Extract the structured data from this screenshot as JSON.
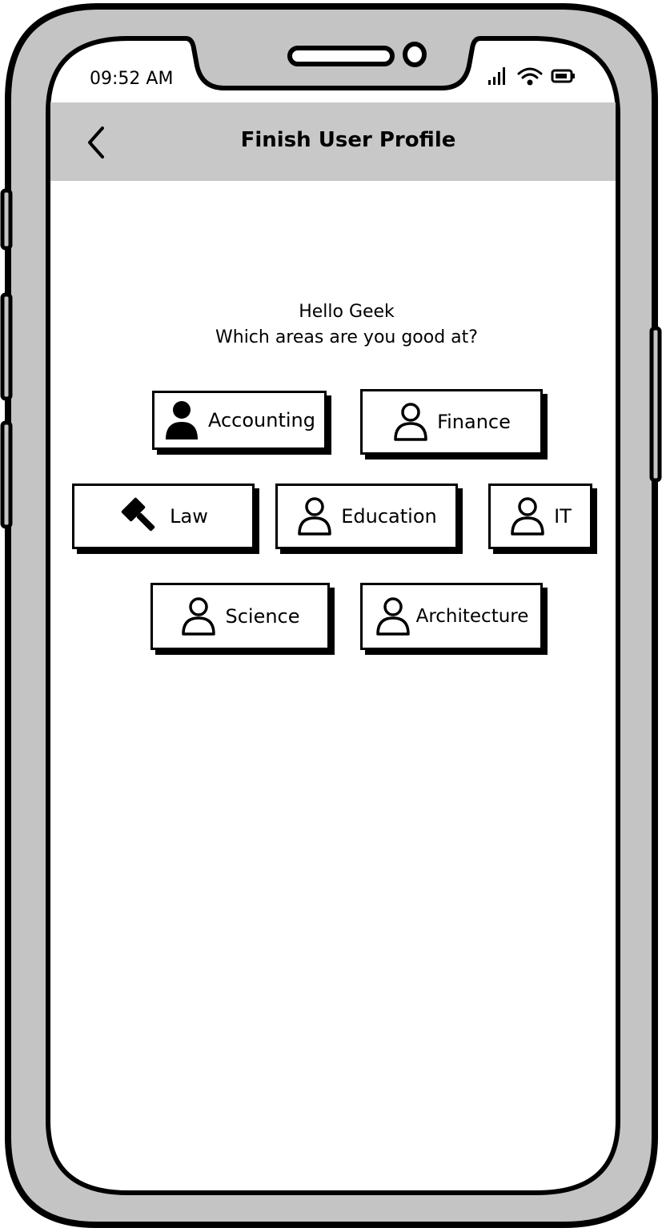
{
  "status_bar": {
    "time": "09:52 AM",
    "icons": [
      "signal-icon",
      "wifi-icon",
      "battery-icon"
    ]
  },
  "header": {
    "title": "Finish User Profile",
    "back_icon": "chevron-left-icon"
  },
  "greeting": {
    "line1": "Hello Geek",
    "line2": "Which areas are you good at?"
  },
  "areas": [
    {
      "label": "Accounting",
      "icon": "user-filled-icon",
      "selected": true
    },
    {
      "label": "Finance",
      "icon": "user-outline-icon",
      "selected": false
    },
    {
      "label": "Law",
      "icon": "gavel-icon",
      "selected": true
    },
    {
      "label": "Education",
      "icon": "user-outline-icon",
      "selected": false
    },
    {
      "label": "IT",
      "icon": "user-outline-icon",
      "selected": false
    },
    {
      "label": "Science",
      "icon": "user-outline-icon",
      "selected": false
    },
    {
      "label": "Architecture",
      "icon": "user-outline-icon",
      "selected": false
    }
  ],
  "colors": {
    "frame": "#c4c4c4",
    "header_bg": "#c8c8c8",
    "ink": "#000000",
    "screen": "#ffffff"
  }
}
